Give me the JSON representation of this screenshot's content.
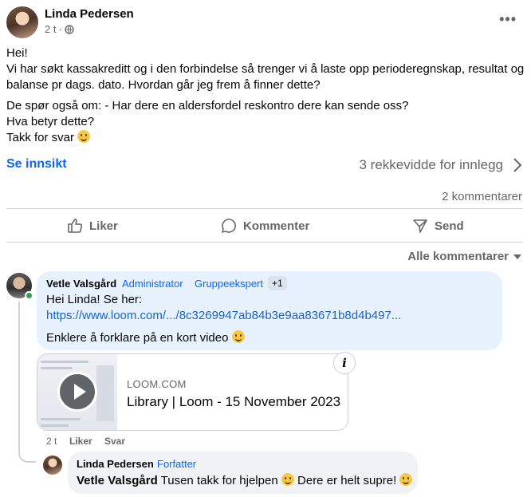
{
  "post": {
    "author": "Linda Pedersen",
    "time": "2 t",
    "audience_icon": "globe-icon",
    "more_icon": "ellipsis-icon",
    "more_label": "•••",
    "greeting": "Hei!",
    "paragraph1": "Vi har søkt kassakreditt og i den forbindelse så trenger vi å laste opp perioderegnskap, resultat og balanse pr dags. dato. Hvordan går jeg frem å finner dette?",
    "line2": "De spør også om: - Har dere en aldersfordel reskontro dere kan sende oss?",
    "line3": "Hva betyr dette?",
    "line4": "Takk for svar"
  },
  "stats": {
    "insight_label": "Se innsikt",
    "reach_label": "3 rekkevidde for innlegg",
    "comments_label": "2 kommentarer"
  },
  "actions": {
    "like": "Liker",
    "comment": "Kommenter",
    "send": "Send"
  },
  "comments_filter": "Alle kommentarer",
  "comment1": {
    "author": "Vetle Valsgård",
    "badge1": "Administrator",
    "badge2": "Gruppeekspert",
    "badge_more": "+1",
    "line1": "Hei Linda! Se her:",
    "link": "https://www.loom.com/.../8c3269947ab84b3e9aa83671b8d4b497...",
    "line2": "Enklere å forklare på en kort video",
    "preview": {
      "domain": "LOOM.COM",
      "title": "Library | Loom - 15 November 2023",
      "info_label": "i"
    },
    "time": "2 t",
    "like": "Liker",
    "reply": "Svar"
  },
  "reply1": {
    "author": "Linda Pedersen",
    "badge": "Forfatter",
    "mention": "Vetle Valsgård",
    "text1": "Tusen takk for hjelpen",
    "text2": "Dere er helt supre!"
  },
  "colors": {
    "accent": "#0866ff",
    "muted": "#65676b",
    "bubble_highlight": "#e8f2ff",
    "bubble": "#f0f2f5"
  }
}
